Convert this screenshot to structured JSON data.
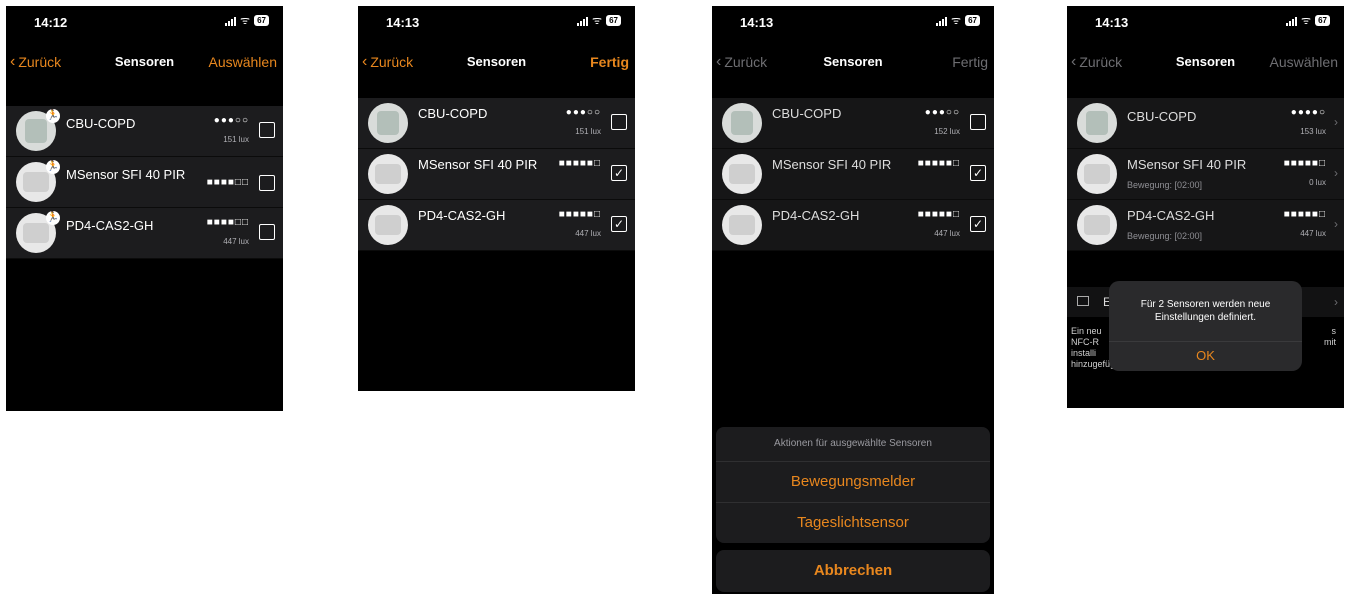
{
  "screens": [
    {
      "time": "14:12",
      "battery": "67",
      "nav": {
        "back": "Zurück",
        "title": "Sensoren",
        "right": "Auswählen"
      },
      "rows": [
        {
          "name": "CBU-COPD",
          "signal": "●●●○○",
          "lux": "151 lux",
          "checked": ""
        },
        {
          "name": "MSensor SFI 40 PIR",
          "signal": "■■■■□□",
          "lux": "",
          "checked": ""
        },
        {
          "name": "PD4-CAS2-GH",
          "signal": "■■■■□□",
          "lux": "447 lux",
          "checked": ""
        }
      ]
    },
    {
      "time": "14:13",
      "battery": "67",
      "nav": {
        "back": "Zurück",
        "title": "Sensoren",
        "right": "Fertig"
      },
      "rows": [
        {
          "name": "CBU-COPD",
          "signal": "●●●○○",
          "lux": "151 lux",
          "checked": ""
        },
        {
          "name": "MSensor SFI 40 PIR",
          "signal": "■■■■■□",
          "lux": "",
          "checked": "✓"
        },
        {
          "name": "PD4-CAS2-GH",
          "signal": "■■■■■□",
          "lux": "447 lux",
          "checked": "✓"
        }
      ]
    },
    {
      "time": "14:13",
      "battery": "67",
      "nav": {
        "back": "Zurück",
        "title": "Sensoren",
        "right": "Fertig"
      },
      "rows": [
        {
          "name": "CBU-COPD",
          "signal": "●●●○○",
          "lux": "152 lux",
          "checked": ""
        },
        {
          "name": "MSensor SFI 40 PIR",
          "signal": "■■■■■□",
          "lux": "",
          "checked": "✓"
        },
        {
          "name": "PD4-CAS2-GH",
          "signal": "■■■■■□",
          "lux": "447 lux",
          "checked": "✓"
        }
      ],
      "sheet": {
        "title": "Aktionen für ausgewählte Sensoren",
        "option1": "Bewegungsmelder",
        "option2": "Tageslichtsensor",
        "cancel": "Abbrechen"
      }
    },
    {
      "time": "14:13",
      "battery": "67",
      "nav": {
        "back": "Zurück",
        "title": "Sensoren",
        "right": "Auswählen"
      },
      "rows": [
        {
          "name": "CBU-COPD",
          "sub": "",
          "signal": "●●●●○",
          "lux": "153 lux"
        },
        {
          "name": "MSensor SFI 40 PIR",
          "sub": "Bewegung:  [02:00]",
          "signal": "■■■■■□",
          "lux": "0 lux"
        },
        {
          "name": "PD4-CAS2-GH",
          "sub": "Bewegung:  [02:00]",
          "signal": "■■■■■□",
          "lux": "447 lux"
        }
      ],
      "settings_label": "E",
      "footer_left": [
        "Ein neu",
        "NFC-R",
        "installi",
        "hinzugefügt werden."
      ],
      "footer_right": [
        "s",
        "mit"
      ],
      "alert": {
        "message_line1": "Für 2 Sensoren werden neue",
        "message_line2": "Einstellungen definiert.",
        "ok": "OK"
      }
    }
  ]
}
